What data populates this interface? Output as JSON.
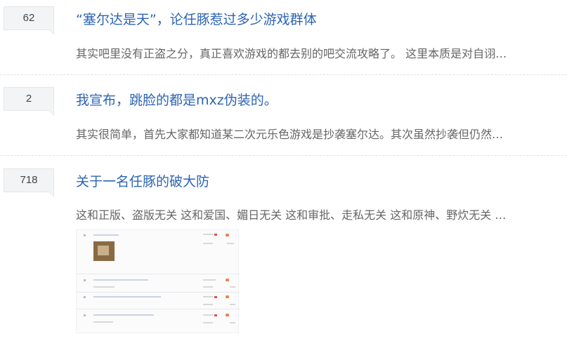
{
  "threads": [
    {
      "reply_count": "62",
      "title": "“塞尔达是天”，论任豚惹过多少游戏群体",
      "abstract": "其实吧里没有正盗之分，真正喜欢游戏的都去别的吧交流攻略了。 这里本质是对自诩…"
    },
    {
      "reply_count": "2",
      "title": "我宣布，跳脸的都是mxz伪装的。",
      "abstract": "其实很简单，首先大家都知道某二次元乐色游戏是抄袭塞尔达。其次虽然抄袭但仍然…"
    },
    {
      "reply_count": "718",
      "title": "关于一名任豚的破大防",
      "abstract": "这和正版、盗版无关 这和爱国、媚日无关 这和审批、走私无关 这和原神、野炊无关 …"
    }
  ],
  "colors": {
    "title_link": "#2d64b3",
    "abstract_text": "#666666",
    "badge_bg": "#f3f4f6"
  }
}
